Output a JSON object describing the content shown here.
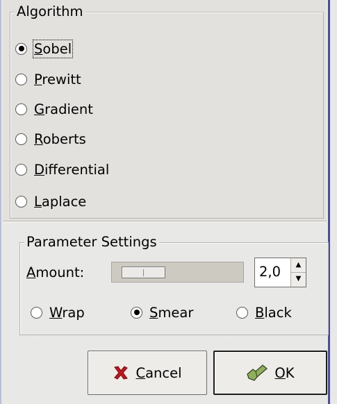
{
  "algorithm": {
    "legend": "Algorithm",
    "options": [
      {
        "label_mn": "S",
        "label_rest": "obel",
        "checked": true
      },
      {
        "label_mn": "P",
        "label_rest": "rewitt",
        "checked": false
      },
      {
        "label_mn": "G",
        "label_rest": "radient",
        "checked": false
      },
      {
        "label_mn": "R",
        "label_rest": "oberts",
        "checked": false
      },
      {
        "label_mn": "D",
        "label_rest": "ifferential",
        "checked": false
      },
      {
        "label_mn": "L",
        "label_rest": "aplace",
        "checked": false
      }
    ]
  },
  "parameters": {
    "legend": "Parameter Settings",
    "amount_mn": "A",
    "amount_rest": "mount:",
    "amount_value": "2,0",
    "edge_options": [
      {
        "label_mn": "W",
        "label_rest": "rap",
        "checked": false
      },
      {
        "label_mn": "S",
        "label_rest": "mear",
        "checked": true
      },
      {
        "label_mn": "B",
        "label_rest": "lack",
        "checked": false
      }
    ]
  },
  "buttons": {
    "cancel_mn": "C",
    "cancel_rest": "ancel",
    "ok_mn": "O",
    "ok_rest": "K"
  },
  "icons": {
    "cancel": "cancel-x-icon",
    "ok": "ok-check-icon"
  },
  "colors": {
    "cancel_icon_red": "#c4161c",
    "ok_icon_green": "#8fb05a",
    "frame_accent": "#4a4e9a"
  }
}
